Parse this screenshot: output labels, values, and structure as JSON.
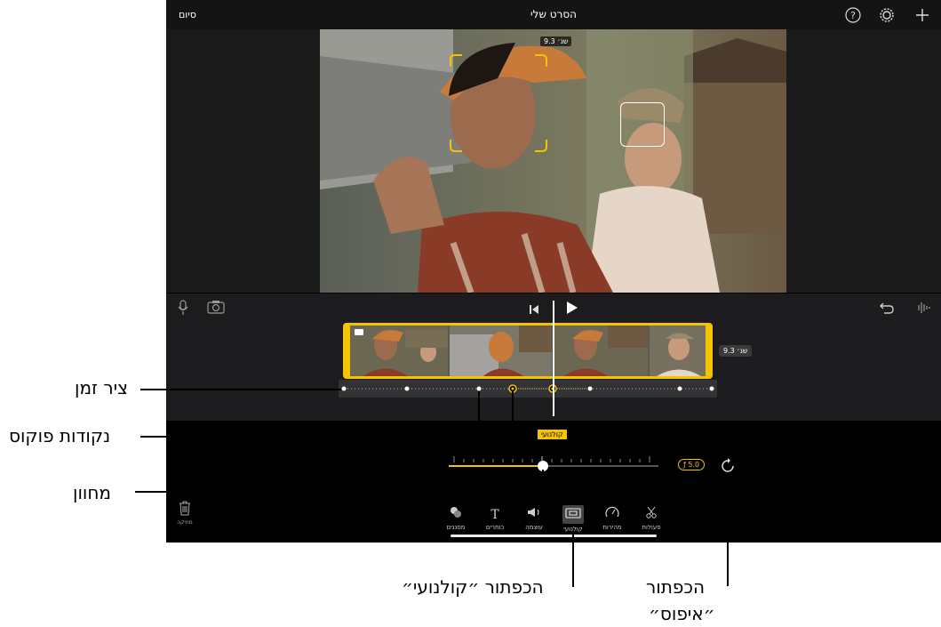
{
  "app": {
    "title": "הסרט שלי",
    "done_label": "סיום"
  },
  "viewer": {
    "time_badge": "9.3 שנ׳"
  },
  "timeline": {
    "duration_badge": "9.3 שנ׳"
  },
  "cinematic": {
    "label": "קולנועי",
    "aperture": "ƒ 5.0",
    "slider_value": 0.45
  },
  "toolbar": {
    "trash_label": "מחיקה",
    "items": [
      {
        "label": "מסננים",
        "icon": "filters-icon"
      },
      {
        "label": "כותרים",
        "icon": "titles-icon"
      },
      {
        "label": "עוצמה",
        "icon": "volume-icon"
      },
      {
        "label": "קולנועי",
        "icon": "cinematic-icon"
      },
      {
        "label": "מהירות",
        "icon": "speed-icon"
      },
      {
        "label": "פעולות",
        "icon": "scissors-icon"
      }
    ]
  },
  "callouts": {
    "timeline": "ציר זמן",
    "focus_points": "נקודות פוקוס",
    "slider": "מחוון",
    "cinematic_button": "הכפתור ״קולנועי״",
    "reset_button_line1": "הכפתור",
    "reset_button_line2": "״איפוס״"
  },
  "colors": {
    "accent": "#f5c400",
    "background": "#000000"
  }
}
